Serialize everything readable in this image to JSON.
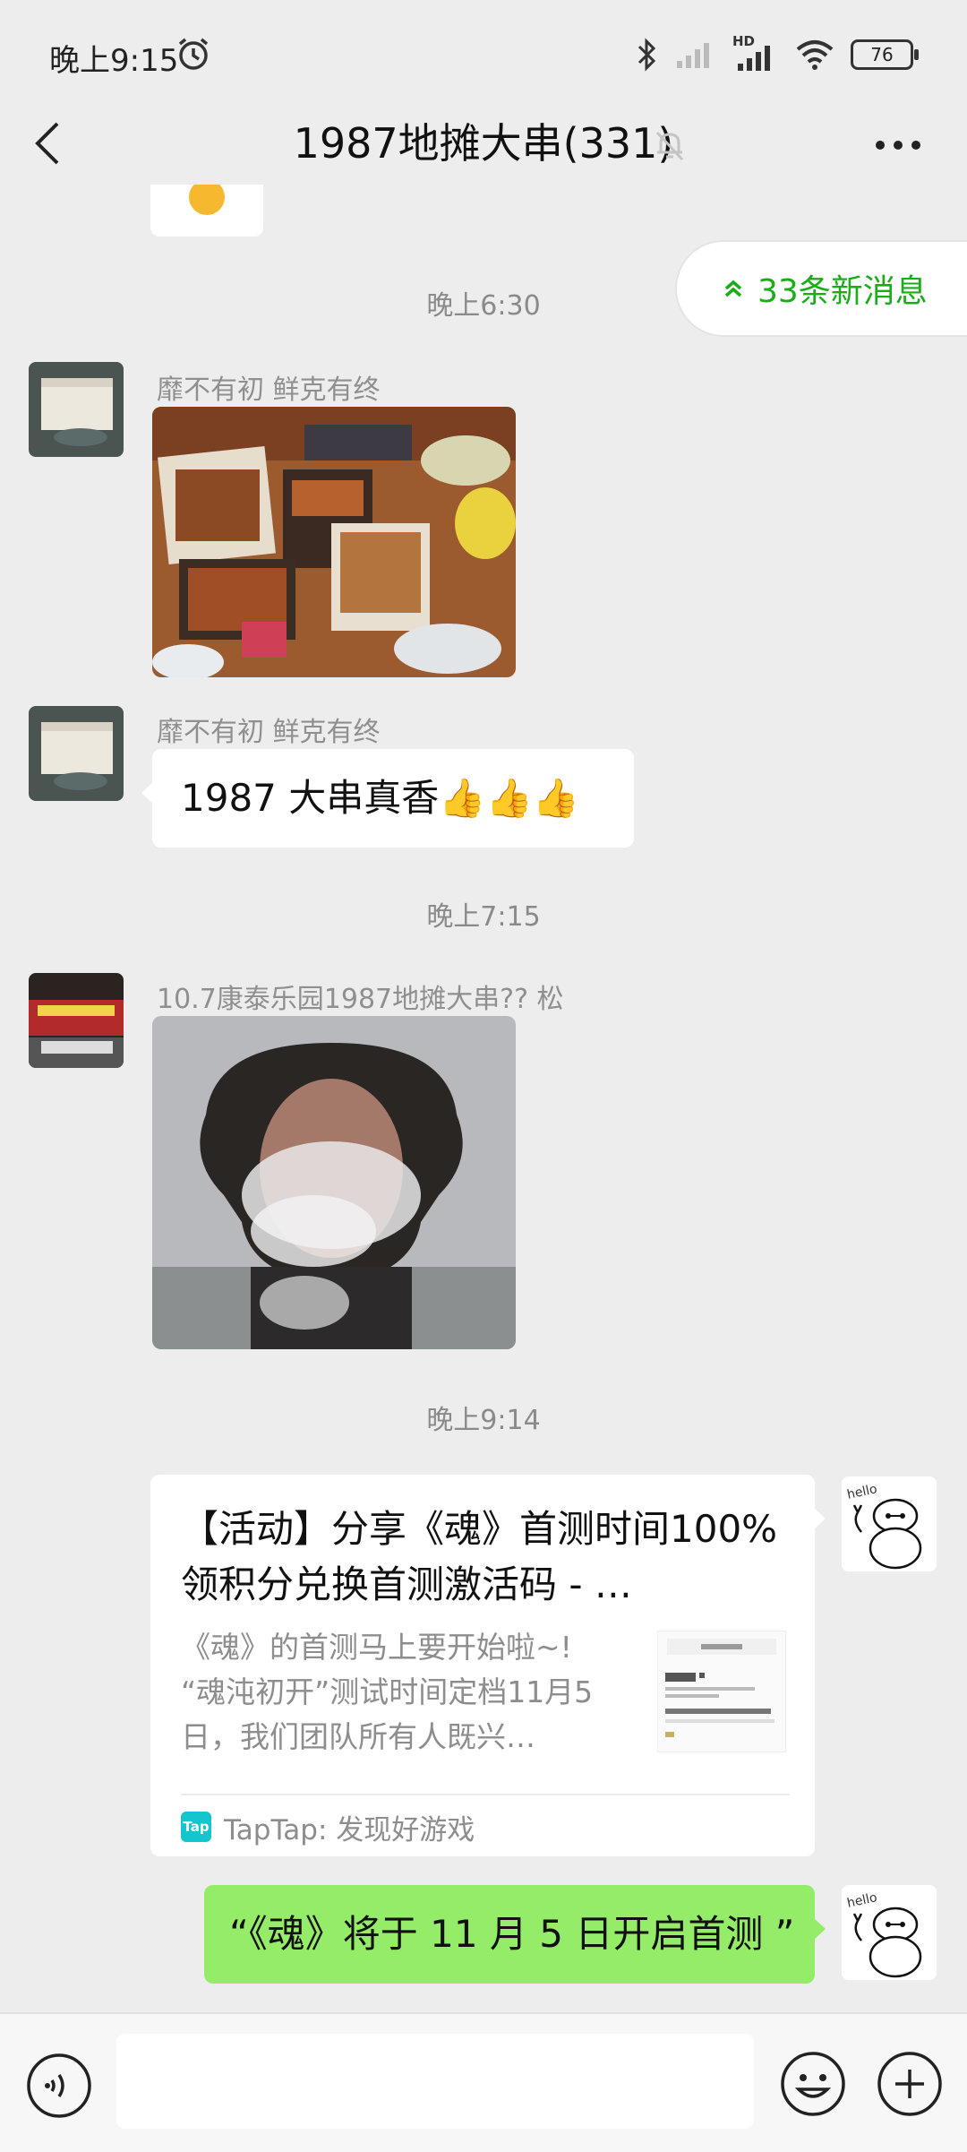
{
  "status_bar": {
    "time": "晚上9:15",
    "battery": "76",
    "network": "HD"
  },
  "header": {
    "title": "1987地摊大串(331)"
  },
  "new_messages": {
    "label": "33条新消息"
  },
  "messages": [
    {
      "type": "timestamp",
      "text": "晚上6:30"
    },
    {
      "type": "image",
      "sender": "靡不有初  鲜克有终",
      "side": "left"
    },
    {
      "type": "text",
      "sender": "靡不有初  鲜克有终",
      "text": "1987 大串真香👍👍👍",
      "side": "left"
    },
    {
      "type": "timestamp",
      "text": "晚上7:15"
    },
    {
      "type": "image",
      "sender": "10.7康泰乐园1987地摊大串?? 松",
      "side": "left"
    },
    {
      "type": "timestamp",
      "text": "晚上9:14"
    },
    {
      "type": "link",
      "side": "right",
      "title": "【活动】分享《魂》首测时间100%领积分兑换首测激活码 - …",
      "desc": "《魂》的首测马上要开始啦~! “魂沌初开”测试时间定档11月5日，我们团队所有人既兴…",
      "source": "TapTap: 发现好游戏",
      "source_logo": "Tap"
    },
    {
      "type": "text",
      "side": "right",
      "text": "“《魂》将于 11 月 5 日开启首测 ”"
    }
  ],
  "input": {
    "placeholder": ""
  },
  "colors": {
    "accent_green": "#1aad19",
    "bubble_green": "#95ec69",
    "background": "#ededed"
  }
}
